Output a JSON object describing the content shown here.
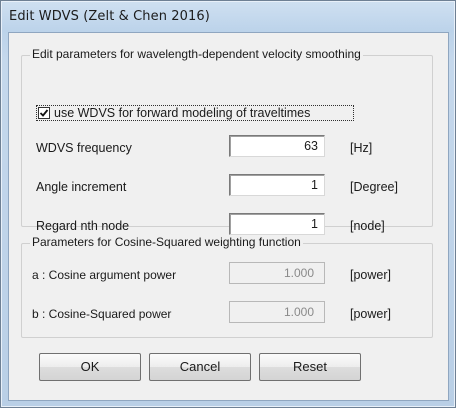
{
  "window": {
    "title": "Edit WDVS (Zelt & Chen 2016)"
  },
  "group1": {
    "title": "Edit parameters for wavelength-dependent velocity smoothing",
    "checkbox": {
      "label": "use WDVS for forward modeling of traveltimes",
      "checked": true
    },
    "rows": [
      {
        "label": "WDVS frequency",
        "value": "63",
        "unit": "[Hz]"
      },
      {
        "label": "Angle increment",
        "value": "1",
        "unit": "[Degree]"
      },
      {
        "label": "Regard nth node",
        "value": "1",
        "unit": "[node]"
      }
    ]
  },
  "group2": {
    "title": "Parameters for Cosine-Squared weighting function",
    "rows": [
      {
        "label": "a : Cosine argument power",
        "value": "1.000",
        "unit": "[power]"
      },
      {
        "label": "b : Cosine-Squared power",
        "value": "1.000",
        "unit": "[power]"
      }
    ]
  },
  "buttons": {
    "ok": "OK",
    "cancel": "Cancel",
    "reset": "Reset"
  }
}
